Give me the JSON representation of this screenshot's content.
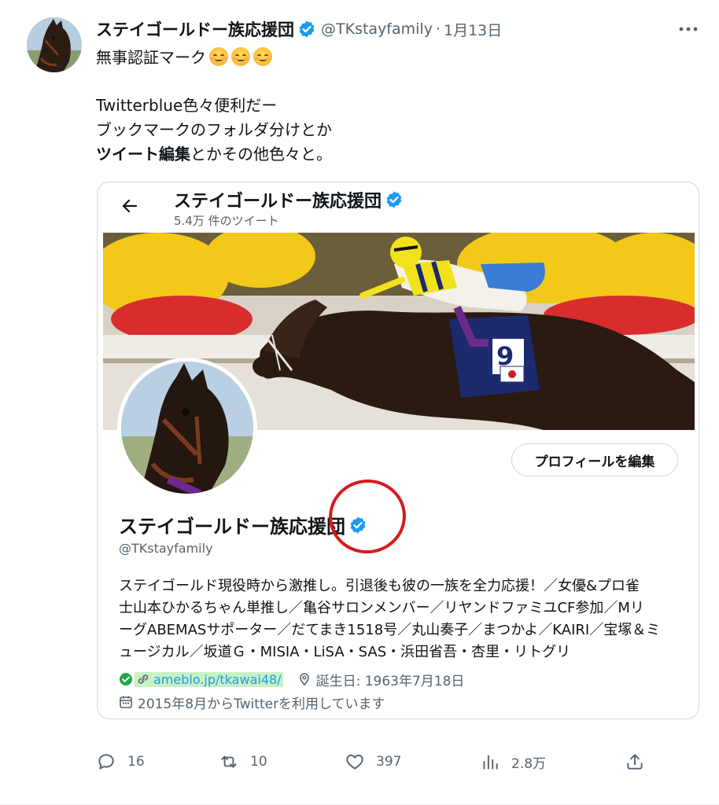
{
  "tweet": {
    "author": {
      "display_name": "ステイゴールドー族応援団",
      "handle": "@TKstayfamily",
      "verified_icon": "verified-badge-icon",
      "avatar": "horse-avatar"
    },
    "dot": "·",
    "date": "1月13日",
    "more_icon": "more-icon",
    "text": {
      "line1": "無事認証マーク",
      "line2": "Twitterblue色々便利だー",
      "line3": "ブックマークのフォルダ分けとか",
      "line4_bold": "ツイート編集",
      "line4_rest": "とかその他色々と。"
    },
    "emoji": [
      "smiling-face-emoji",
      "smiling-face-emoji",
      "smiling-face-emoji"
    ]
  },
  "embedded_profile": {
    "back_icon": "back-arrow-icon",
    "header_title": "ステイゴールドー族応援団",
    "header_subtitle": "5.4万 件のツイート",
    "banner": "horse-racing-banner",
    "edit_button": "プロフィールを編集",
    "name": "ステイゴールドー族応援団",
    "handle": "@TKstayfamily",
    "bio_lines": [
      "ステイゴールド現役時から激推し。引退後も彼の一族を全力応援！／女優&プロ雀",
      "士山本ひかるちゃん単推し／亀谷サロンメンバー／リヤンドファミユCF参加／Mリ",
      "ーグABEMASサポーター／だてまき1518号／丸山奏子／まつかよ／KAIRI／宝塚＆ミ",
      "ュージカル／坂道Ｇ・MISIA・LiSA・SAS・浜田省吾・杏里・リトグリ"
    ],
    "link": "ameblo.jp/tkawai48/",
    "birthday": "誕生日: 1963年7月18日",
    "joined": "2015年8月からTwitterを利用しています"
  },
  "actions": {
    "reply_count": "16",
    "retweet_count": "10",
    "like_count": "397",
    "views_count": "2.8万"
  },
  "colors": {
    "accent": "#1d9bf0",
    "secondary_text": "#536471",
    "annotation_circle": "#d7191c",
    "link_highlight": "#c9f1c5"
  }
}
